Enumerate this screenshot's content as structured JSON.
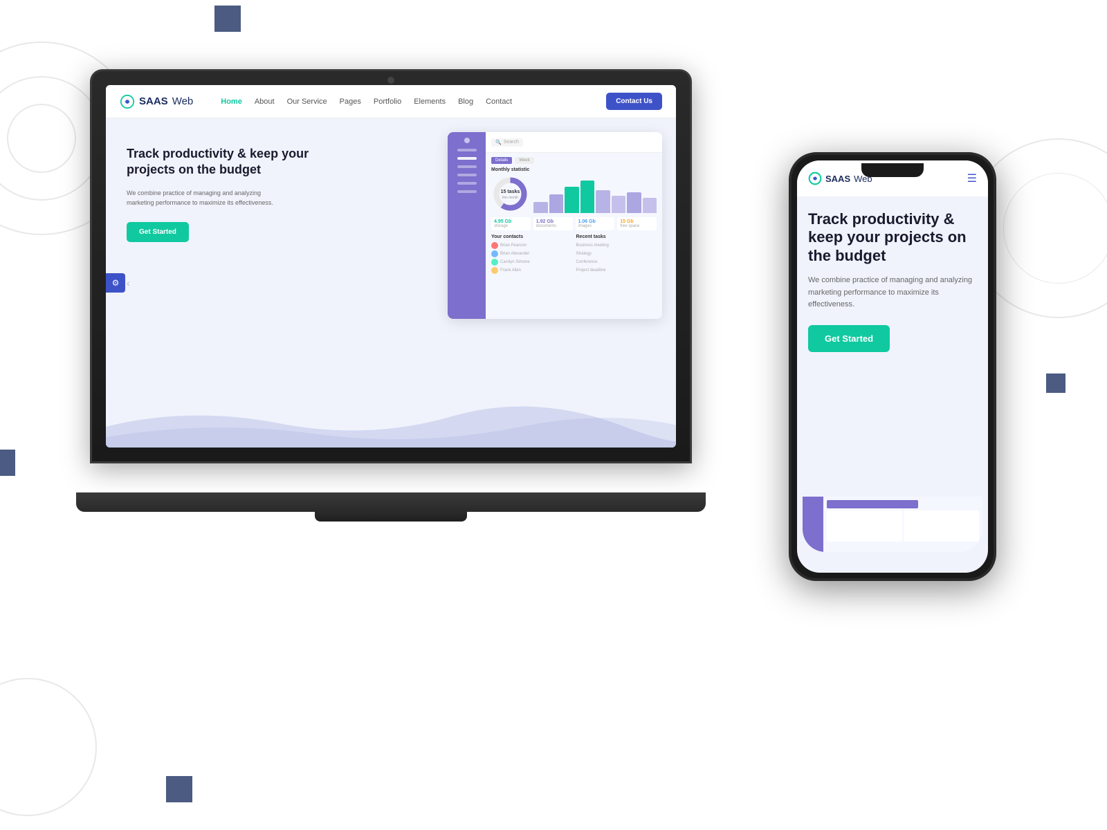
{
  "background": {
    "color": "#ffffff"
  },
  "laptop": {
    "website": {
      "logo": "SAASWeb",
      "logo_s": "SAAS",
      "logo_w": "Web",
      "nav": {
        "items": [
          "Home",
          "About",
          "Our Service",
          "Pages",
          "Portfolio",
          "Elements",
          "Blog",
          "Contact"
        ],
        "active": "Home",
        "contact_btn": "Contact Us"
      },
      "hero": {
        "title": "Track productivity & keep your projects on the budget",
        "description": "We combine practice of managing and analyzing marketing performance to maximize its effectiveness.",
        "cta": "Get Started"
      },
      "dashboard": {
        "search_placeholder": "Search",
        "tabs": [
          "Details",
          "Week"
        ],
        "chart_title": "Monthly statistic",
        "stats": [
          {
            "value": "4.95 Gb",
            "label": "storage"
          },
          {
            "value": "1.92 Gb",
            "label": "documents"
          },
          {
            "value": "1.06 Gb",
            "label": "images"
          },
          {
            "value": "15 Gb",
            "label": "free space"
          }
        ],
        "contacts_title": "Your contacts",
        "tasks_title": "Recent tasks"
      }
    }
  },
  "phone": {
    "website": {
      "logo": "SAASWeb",
      "logo_s": "SAAS",
      "logo_w": "Web",
      "hero": {
        "title": "Track productivity & keep your projects on the budget",
        "description": "We combine practice of managing and analyzing marketing performance to maximize its effectiveness.",
        "cta": "Get Started"
      }
    }
  },
  "decorative": {
    "square_color": "#2c3e6b"
  }
}
